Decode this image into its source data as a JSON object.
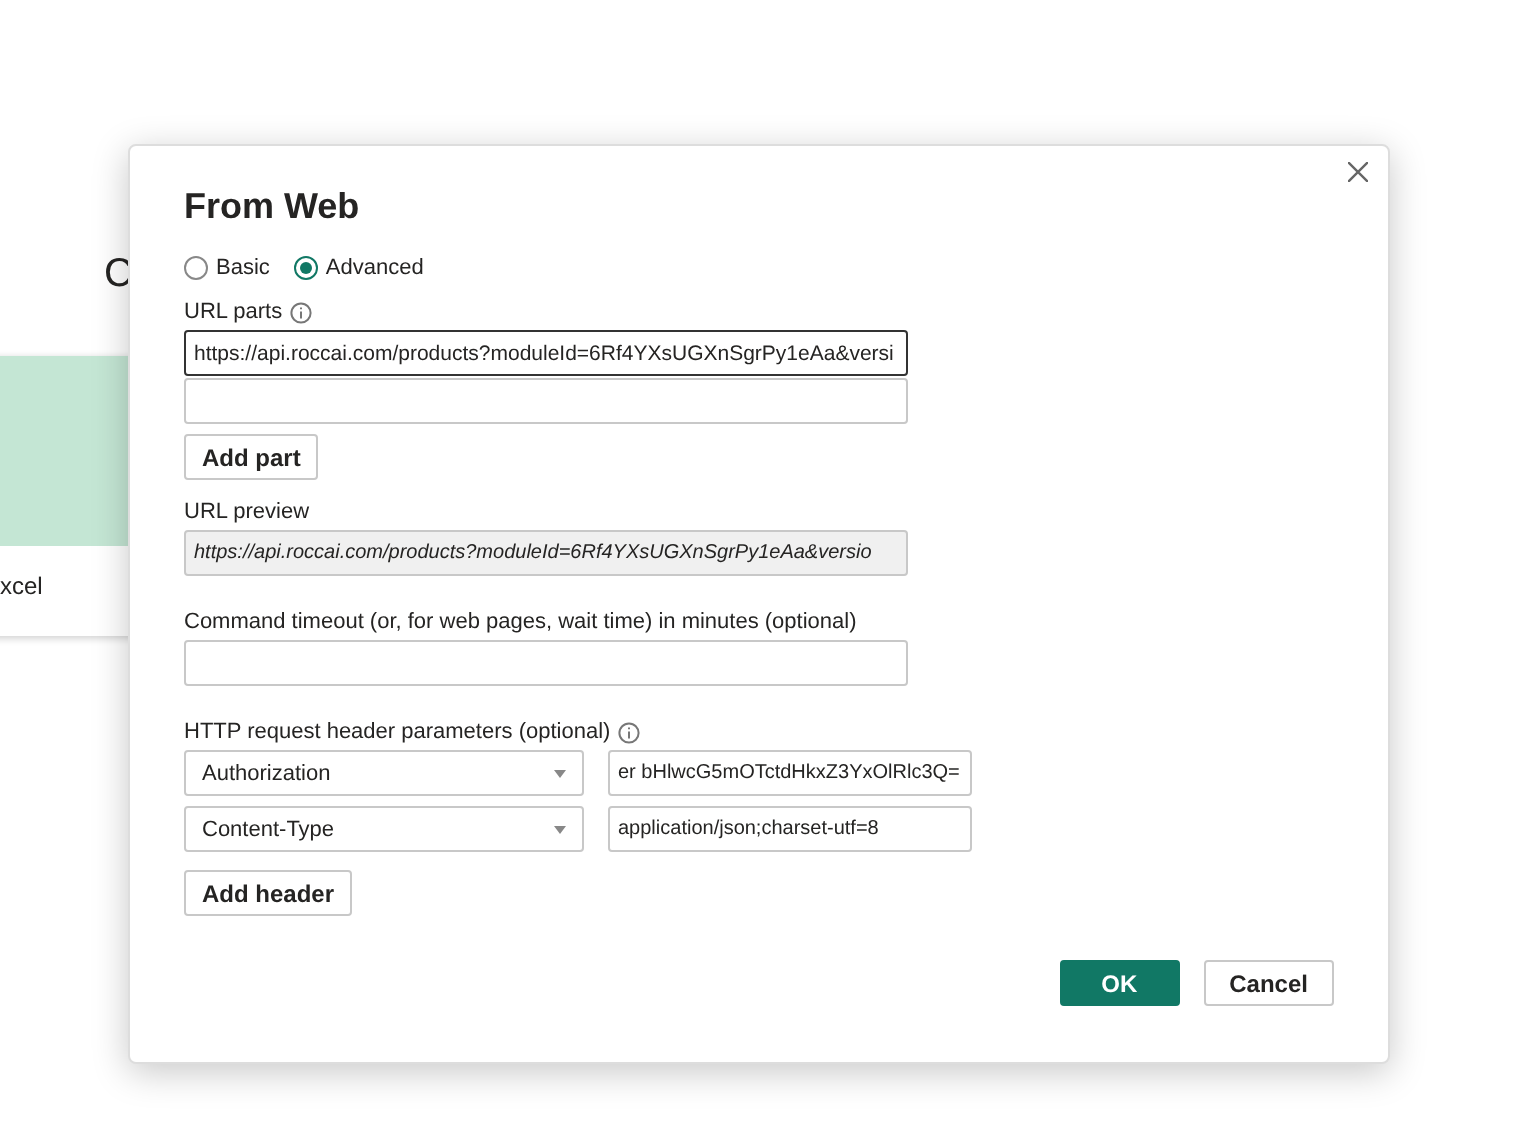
{
  "background": {
    "heading": "C",
    "card_label": "xcel"
  },
  "dialog": {
    "title": "From Web",
    "modes": [
      {
        "label": "Basic",
        "selected": false
      },
      {
        "label": "Advanced",
        "selected": true
      }
    ],
    "url_parts": {
      "label": "URL parts",
      "fields": [
        {
          "value": "https://api.roccai.com/products?moduleId=6Rf4YXsUGXnSgrPy1eAa&versi",
          "focused": true
        },
        {
          "focused": false
        }
      ],
      "add_button": "Add part"
    },
    "url_preview": {
      "label": "URL preview",
      "value": "https://api.roccai.com/products?moduleId=6Rf4YXsUGXnSgrPy1eAa&versio"
    },
    "timeout": {
      "label": "Command timeout (or, for web pages, wait time) in minutes (optional)"
    },
    "headers": {
      "label": "HTTP request header parameters (optional)",
      "rows": [
        {
          "name": "Authorization",
          "value": "er bHlwcG5mOTctdHkxZ3YxOlRlc3Q="
        },
        {
          "name": "Content-Type",
          "value": "application/json;charset-utf=8"
        }
      ],
      "add_button": "Add header"
    },
    "buttons": [
      {
        "label": "OK",
        "kind": "primary"
      },
      {
        "label": "Cancel",
        "kind": "secondary"
      }
    ]
  }
}
